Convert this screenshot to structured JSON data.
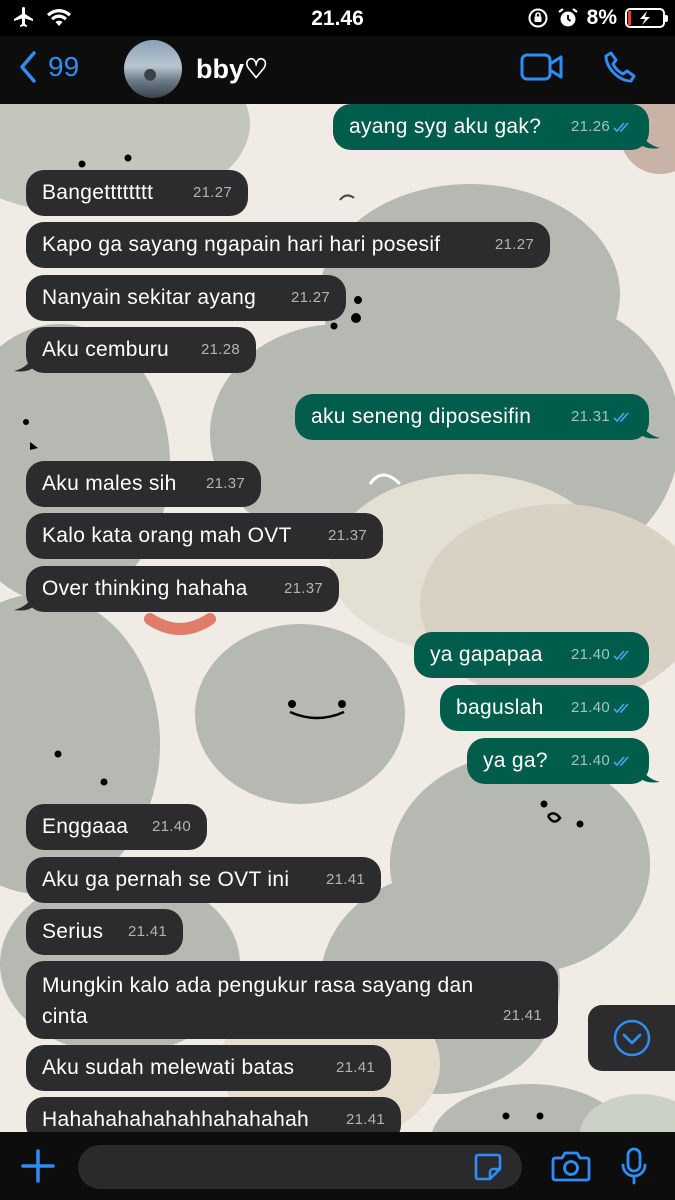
{
  "status": {
    "time": "21.46",
    "battery": "8%"
  },
  "header": {
    "back_count": "99",
    "contact_name": "bby♡"
  },
  "messages": [
    {
      "dir": "out",
      "text": "ayang syg aku gak?",
      "time": "21.26"
    },
    {
      "dir": "in",
      "text": "Bangetttttttt",
      "time": "21.27"
    },
    {
      "dir": "in",
      "text": "Kapo ga sayang ngapain hari hari posesif",
      "time": "21.27"
    },
    {
      "dir": "in",
      "text": "Nanyain sekitar ayang",
      "time": "21.27"
    },
    {
      "dir": "in",
      "text": "Aku cemburu",
      "time": "21.28"
    },
    {
      "dir": "out",
      "text": "aku seneng diposesifin",
      "time": "21.31"
    },
    {
      "dir": "in",
      "text": "Aku males sih",
      "time": "21.37"
    },
    {
      "dir": "in",
      "text": "Kalo kata orang mah OVT",
      "time": "21.37"
    },
    {
      "dir": "in",
      "text": "Over thinking hahaha",
      "time": "21.37"
    },
    {
      "dir": "out",
      "text": "ya gapapaa",
      "time": "21.40"
    },
    {
      "dir": "out",
      "text": "baguslah",
      "time": "21.40"
    },
    {
      "dir": "out",
      "text": "ya ga?",
      "time": "21.40"
    },
    {
      "dir": "in",
      "text": "Enggaaa",
      "time": "21.40"
    },
    {
      "dir": "in",
      "text": "Aku ga pernah se OVT ini",
      "time": "21.41"
    },
    {
      "dir": "in",
      "text": "Serius",
      "time": "21.41"
    },
    {
      "dir": "in",
      "text": "Mungkin kalo ada pengukur rasa sayang dan cinta",
      "time": "21.41"
    },
    {
      "dir": "in",
      "text": "Aku sudah melewati batas",
      "time": "21.41"
    },
    {
      "dir": "in",
      "text": "Hahahahahahahhahahahah",
      "time": "21.41"
    }
  ],
  "input": {
    "placeholder": ""
  },
  "colors": {
    "accent": "#2f8ef4",
    "incoming_bubble": "#2c2c2e",
    "outgoing_bubble": "#005d4b",
    "read_ticks": "#4fa3f7"
  },
  "icons": [
    "airplane-icon",
    "wifi-icon",
    "orientation-lock-icon",
    "alarm-icon",
    "battery-icon",
    "back-chevron-icon",
    "video-call-icon",
    "phone-icon",
    "scroll-down-icon",
    "plus-icon",
    "sticker-icon",
    "camera-icon",
    "microphone-icon"
  ]
}
